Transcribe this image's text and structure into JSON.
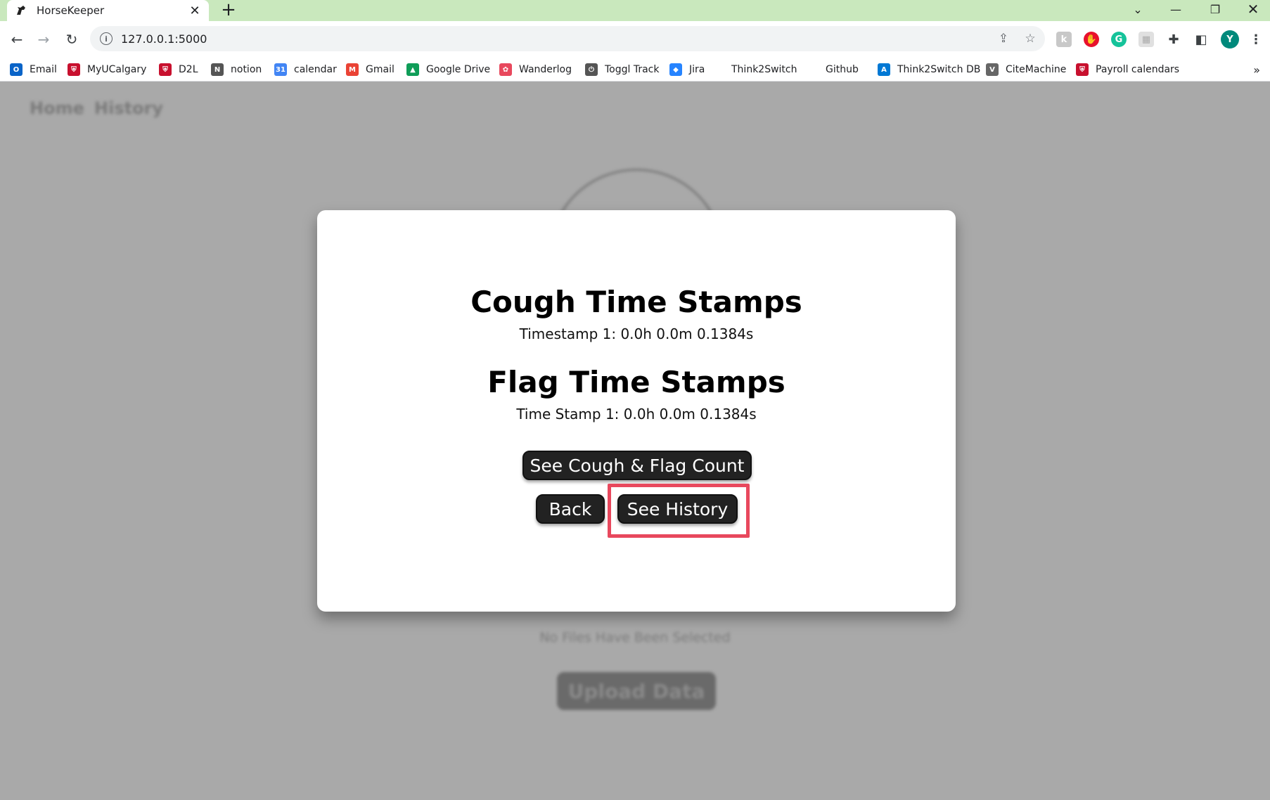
{
  "browser": {
    "tab_title": "HorseKeeper",
    "url": "127.0.0.1:5000",
    "profile_initial": "Y",
    "bookmarks": [
      {
        "label": "Email",
        "icon": "outlook-icon",
        "color": "#0a64c8"
      },
      {
        "label": "MyUCalgary",
        "icon": "ucalgary-crest-icon",
        "color": "#c8102e"
      },
      {
        "label": "D2L",
        "icon": "ucalgary-crest-icon",
        "color": "#c8102e"
      },
      {
        "label": "notion",
        "icon": "notion-icon",
        "color": "#555555"
      },
      {
        "label": "calendar",
        "icon": "google-calendar-icon",
        "color": "#4285f4"
      },
      {
        "label": "Gmail",
        "icon": "gmail-icon",
        "color": "#ea4335"
      },
      {
        "label": "Google Drive",
        "icon": "google-drive-icon",
        "color": "#0f9d58"
      },
      {
        "label": "Wanderlog",
        "icon": "wanderlog-icon",
        "color": "#e8485d"
      },
      {
        "label": "Toggl Track",
        "icon": "toggl-icon",
        "color": "#555555"
      },
      {
        "label": "Jira",
        "icon": "jira-icon",
        "color": "#2684ff"
      },
      {
        "label": "Think2Switch",
        "icon": "blank-icon",
        "color": "#ffffff"
      },
      {
        "label": "Github",
        "icon": "blank-icon",
        "color": "#ffffff"
      },
      {
        "label": "Think2Switch DB",
        "icon": "azure-icon",
        "color": "#0078d4"
      },
      {
        "label": "CiteMachine",
        "icon": "citemachine-icon",
        "color": "#666666"
      },
      {
        "label": "Payroll calendars",
        "icon": "ucalgary-crest-icon",
        "color": "#c8102e"
      }
    ],
    "bookmarks_more": "»"
  },
  "background_page": {
    "nav": {
      "home": "Home",
      "history": "History"
    },
    "no_files_text": "No Files Have Been Selected",
    "upload_label": "Upload Data"
  },
  "modal": {
    "cough_heading": "Cough Time Stamps",
    "cough_stamps": [
      "Timestamp 1: 0.0h 0.0m 0.1384s"
    ],
    "flag_heading": "Flag Time Stamps",
    "flag_stamps": [
      "Time Stamp 1: 0.0h 0.0m 0.1384s"
    ],
    "buttons": {
      "count": "See Cough & Flag Count",
      "back": "Back",
      "history": "See History"
    }
  },
  "colors": {
    "tabstrip": "#c9e8bd",
    "overlay": "#a9a9a9",
    "button": "#222222",
    "highlight": "#e8485d"
  }
}
